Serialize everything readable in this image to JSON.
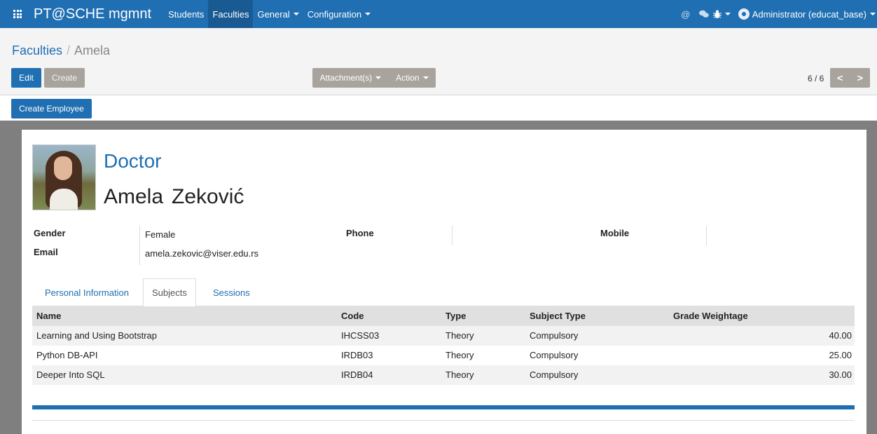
{
  "navbar": {
    "brand": "PT@SCHE mgmnt",
    "menu": [
      {
        "label": "Students"
      },
      {
        "label": "Faculties"
      },
      {
        "label": "General"
      },
      {
        "label": "Configuration"
      }
    ],
    "icons": [
      "at-icon",
      "chat-icon",
      "bug-icon"
    ],
    "user": "Administrator (educat_base)"
  },
  "breadcrumb": {
    "parent": "Faculties",
    "separator": "/",
    "current": "Amela"
  },
  "toolbar": {
    "edit_label": "Edit",
    "create_label": "Create",
    "attachments_label": "Attachment(s)",
    "action_label": "Action"
  },
  "pager": {
    "value": "6 / 6",
    "prev": "<",
    "next": ">"
  },
  "statusbar": {
    "create_employee_label": "Create Employee"
  },
  "profile": {
    "title": "Doctor",
    "first_name": "Amela",
    "last_name": "Zeković"
  },
  "fields": {
    "gender_label": "Gender",
    "gender_value": "Female",
    "email_label": "Email",
    "email_value": "amela.zekovic@viser.edu.rs",
    "phone_label": "Phone",
    "phone_value": "",
    "mobile_label": "Mobile",
    "mobile_value": ""
  },
  "tabs": [
    {
      "label": "Personal Information"
    },
    {
      "label": "Subjects"
    },
    {
      "label": "Sessions"
    }
  ],
  "subjects": {
    "columns": [
      "Name",
      "Code",
      "Type",
      "Subject Type",
      "Grade Weightage"
    ],
    "rows": [
      {
        "name": "Learning and Using Bootstrap",
        "code": "IHCSS03",
        "type": "Theory",
        "subject_type": "Compulsory",
        "grade": "40.00"
      },
      {
        "name": "Python DB-API",
        "code": "IRDB03",
        "type": "Theory",
        "subject_type": "Compulsory",
        "grade": "25.00"
      },
      {
        "name": "Deeper Into SQL",
        "code": "IRDB04",
        "type": "Theory",
        "subject_type": "Compulsory",
        "grade": "30.00"
      }
    ]
  },
  "colors": {
    "primary": "#1f6fb2",
    "secondary_button": "#a9a39d"
  }
}
